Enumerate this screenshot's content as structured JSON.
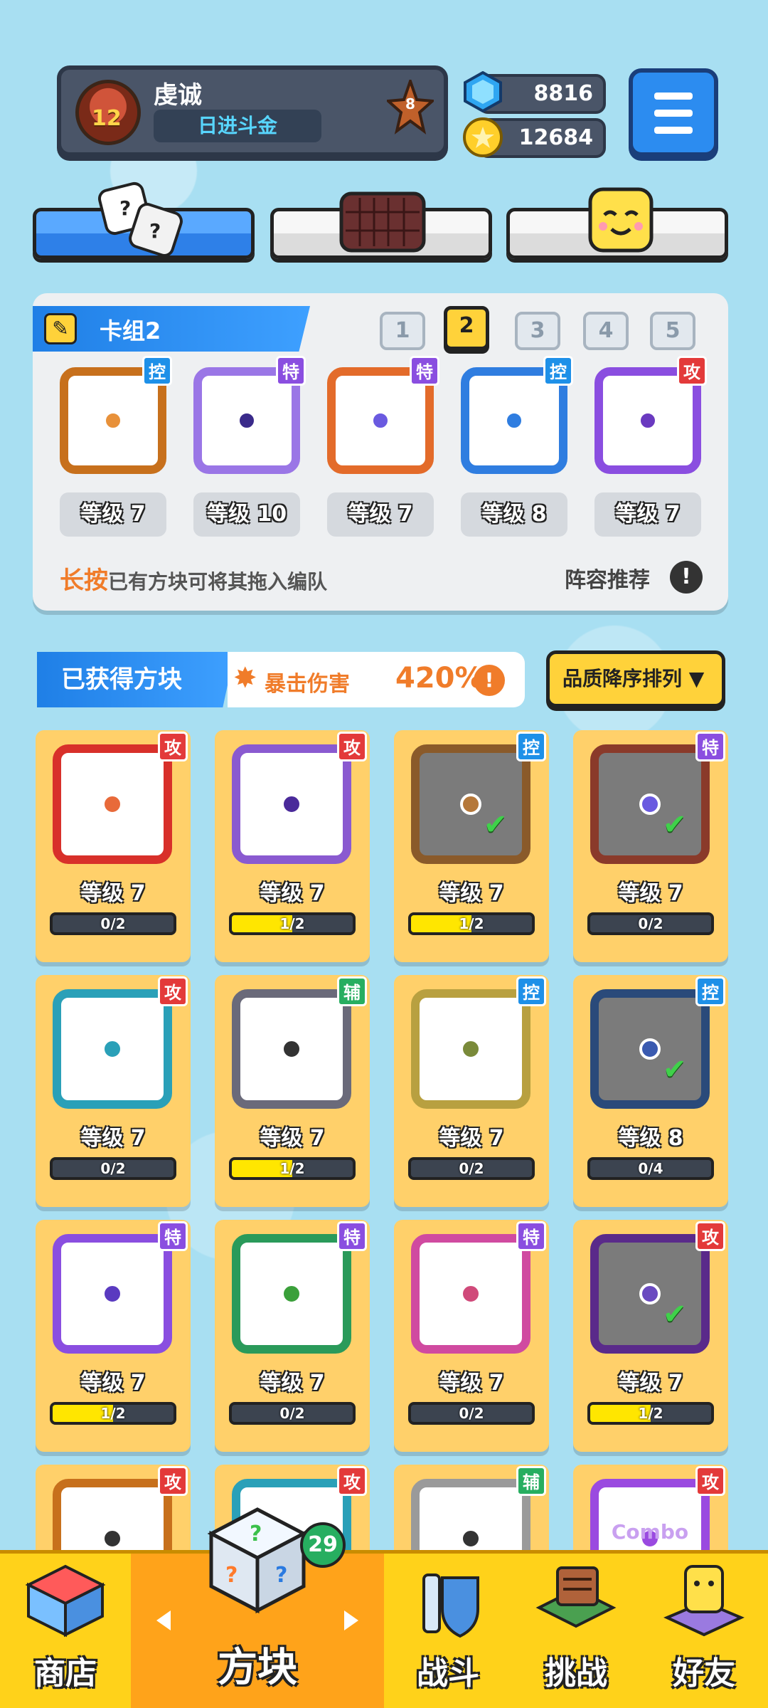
{
  "profile": {
    "name": "虔诚",
    "title": "日进斗金",
    "level": "12",
    "rank": "8"
  },
  "currency": {
    "gems": "8816",
    "coins": "12684"
  },
  "tabs": [
    "dice",
    "board",
    "emote"
  ],
  "deck": {
    "title": "卡组2",
    "numbers": [
      "1",
      "2",
      "3",
      "4",
      "5"
    ],
    "active_index": 1,
    "slots": [
      {
        "badge": "控",
        "level": "等级 7",
        "color": "#c7701c",
        "dot": "#e8913a"
      },
      {
        "badge": "特",
        "level": "等级 10",
        "color": "#9a76e6",
        "dot": "#3a2a8a"
      },
      {
        "badge": "特",
        "level": "等级 7",
        "color": "#e36b2a",
        "dot": "#6a5ae0"
      },
      {
        "badge": "控",
        "level": "等级 8",
        "color": "#2f7de0",
        "dot": "#2f7de0"
      },
      {
        "badge": "攻",
        "level": "等级 7",
        "color": "#8a4ee0",
        "dot": "#6a3ac0"
      }
    ],
    "hint_highlight": "长按",
    "hint_rest": "已有方块可将其拖入编队",
    "recommend": "阵容推荐",
    "recommend_icon": "!"
  },
  "obtained": {
    "title": "已获得方块",
    "crit_label": "暴击伤害",
    "crit_value": "420%",
    "crit_icon": "!",
    "sort_label": "品质降序排列 ▼"
  },
  "cards": [
    {
      "badge": "攻",
      "level": "等级 7",
      "progress": "0/2",
      "fill": 0,
      "color": "#d8302a",
      "dot": "#e86a3a",
      "dim": false,
      "check": false
    },
    {
      "badge": "攻",
      "level": "等级 7",
      "progress": "1/2",
      "fill": 0.5,
      "color": "#8a5ad0",
      "dot": "#4a2a9a",
      "dim": false,
      "check": false
    },
    {
      "badge": "控",
      "level": "等级 7",
      "progress": "1/2",
      "fill": 0.5,
      "color": "#8a5a2a",
      "dot": "#b5783a",
      "dim": true,
      "check": true
    },
    {
      "badge": "特",
      "level": "等级 7",
      "progress": "0/2",
      "fill": 0,
      "color": "#8a3a2a",
      "dot": "#6a5ae0",
      "dim": true,
      "check": true
    },
    {
      "badge": "攻",
      "level": "等级 7",
      "progress": "0/2",
      "fill": 0,
      "color": "#2aa0b8",
      "dot": "#2aa0b8",
      "dim": false,
      "check": false
    },
    {
      "badge": "辅",
      "level": "等级 7",
      "progress": "1/2",
      "fill": 0.5,
      "color": "#6a6a7a",
      "dot": "#333333",
      "dim": false,
      "check": false
    },
    {
      "badge": "控",
      "level": "等级 7",
      "progress": "0/2",
      "fill": 0,
      "color": "#b8a040",
      "dot": "#7a8a3a",
      "dim": false,
      "check": false
    },
    {
      "badge": "控",
      "level": "等级 8",
      "progress": "0/4",
      "fill": 0,
      "color": "#2a4a7a",
      "dot": "#3a5ab0",
      "dim": true,
      "check": true
    },
    {
      "badge": "特",
      "level": "等级 7",
      "progress": "1/2",
      "fill": 0.5,
      "color": "#8a4ee0",
      "dot": "#5a3ac0",
      "dim": false,
      "check": false
    },
    {
      "badge": "特",
      "level": "等级 7",
      "progress": "0/2",
      "fill": 0,
      "color": "#2a9a5a",
      "dot": "#3aa03a",
      "dim": false,
      "check": false
    },
    {
      "badge": "特",
      "level": "等级 7",
      "progress": "0/2",
      "fill": 0,
      "color": "#d04aa0",
      "dot": "#d04a7a",
      "dim": false,
      "check": false
    },
    {
      "badge": "攻",
      "level": "等级 7",
      "progress": "1/2",
      "fill": 0.5,
      "color": "#5a2a8a",
      "dot": "#6a4ac0",
      "dim": true,
      "check": true
    },
    {
      "badge": "攻",
      "color": "#c7701c",
      "dot": "#333333"
    },
    {
      "badge": "攻",
      "color": "#2aa0b8",
      "dot": "#333333"
    },
    {
      "badge": "辅",
      "color": "#9a9a9a",
      "dot": "#333333"
    },
    {
      "badge": "攻",
      "color": "#9a4ae0",
      "dot": "#9a4ae0",
      "art_text": "Combo"
    }
  ],
  "nav": {
    "shop": "商店",
    "blocks": "方块",
    "blocks_count": "29",
    "battle": "战斗",
    "challenge": "挑战",
    "friends": "好友"
  }
}
